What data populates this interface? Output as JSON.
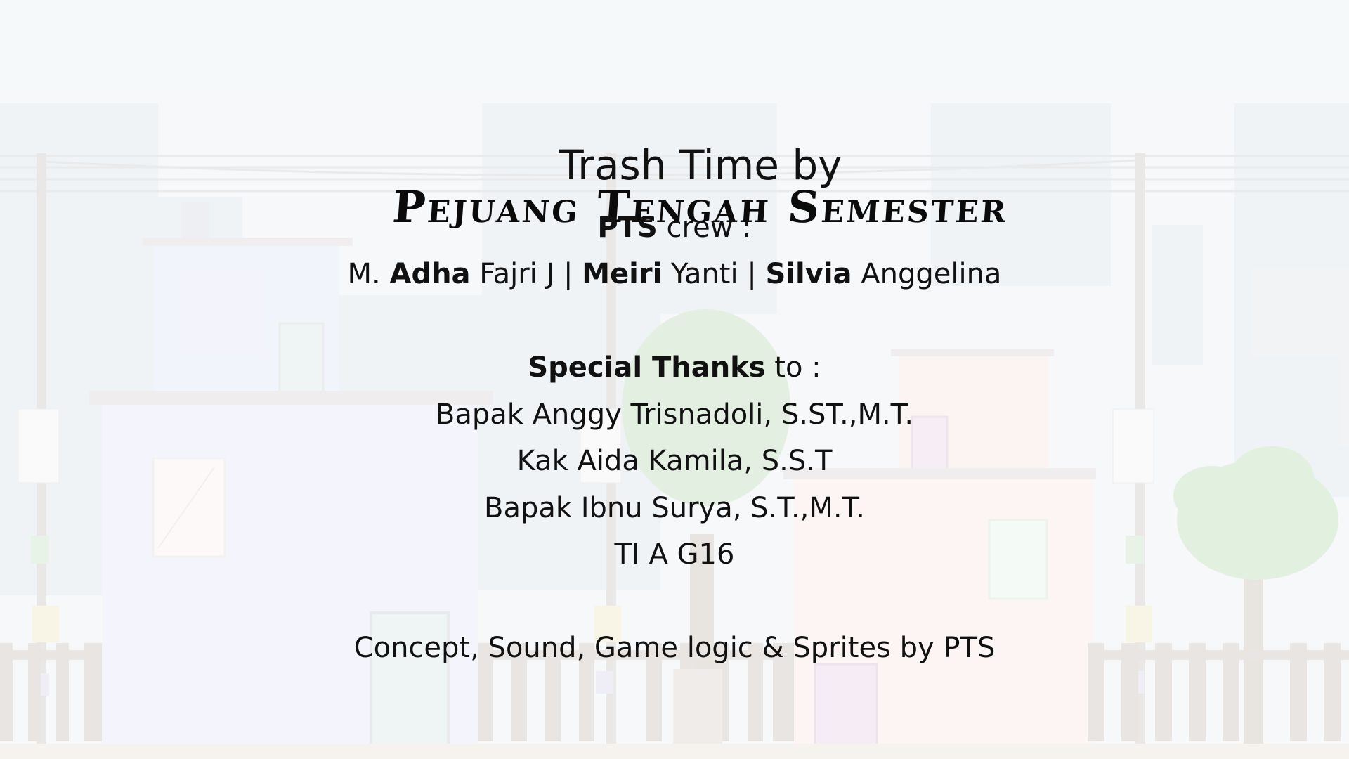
{
  "title": {
    "prefix": "Trash Time by",
    "studio": "Pejuang Tengah Semester"
  },
  "crew": {
    "heading_bold": "PTS",
    "heading_rest": " crew :",
    "members": [
      {
        "first": "M. ",
        "bold": "Adha",
        "last": " Fajri J"
      },
      {
        "first": "",
        "bold": "Meiri",
        "last": " Yanti"
      },
      {
        "first": "",
        "bold": "Silvia",
        "last": " Anggelina"
      }
    ],
    "separator": " | "
  },
  "thanks": {
    "heading_bold": "Special Thanks",
    "heading_rest": " to :",
    "names": [
      "Bapak Anggy Trisnadoli, S.ST.,M.T.",
      "Kak Aida Kamila, S.S.T",
      "Bapak Ibnu Surya, S.T.,M.T.",
      "TI A G16"
    ]
  },
  "footer": "Concept, Sound, Game logic & Sprites by PTS",
  "colors": {
    "sky": "#f1f5f8",
    "text": "#111111",
    "house_blue": "#eef0fb",
    "house_pink": "#fbeeed",
    "tree": "#cfe8cc",
    "fence": "#d9d5d3"
  }
}
